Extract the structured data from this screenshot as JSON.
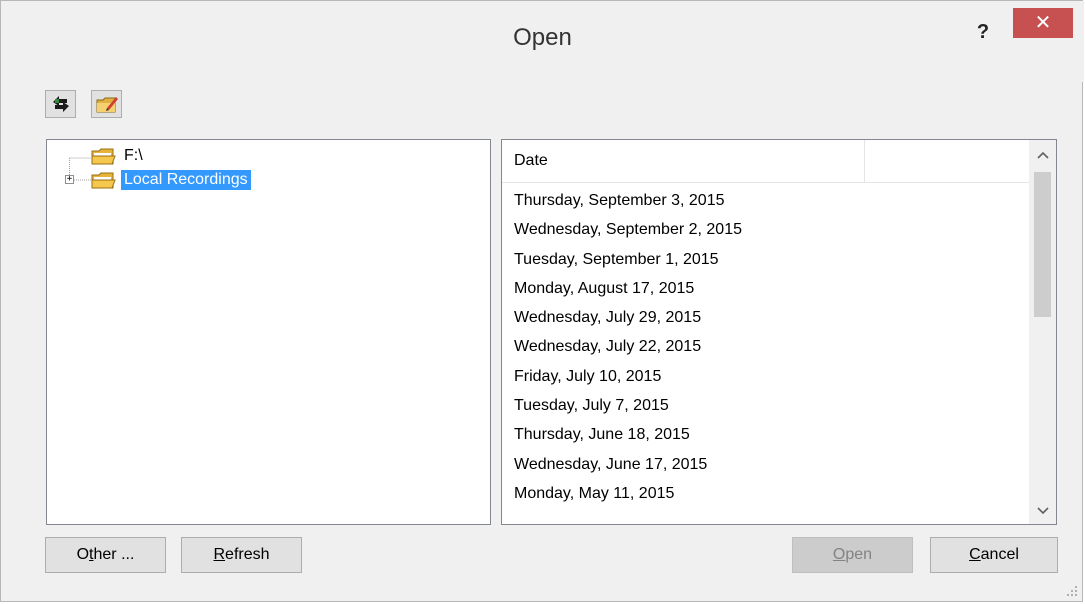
{
  "window": {
    "title": "Open",
    "help_label": "?",
    "close_label": "✕"
  },
  "toolbar": {
    "icons": [
      "refresh-sync-icon",
      "new-folder-icon"
    ]
  },
  "tree": {
    "items": [
      {
        "label": "F:\\",
        "icon": "folder-icon",
        "expandable": false,
        "selected": false
      },
      {
        "label": "Local Recordings",
        "icon": "folder-icon",
        "expandable": true,
        "expander": "+",
        "selected": true
      }
    ]
  },
  "list": {
    "columns": [
      "Date",
      ""
    ],
    "rows": [
      "Thursday, September 3, 2015",
      "Wednesday, September 2, 2015",
      "Tuesday, September 1, 2015",
      "Monday, August 17, 2015",
      "Wednesday, July 29, 2015",
      "Wednesday, July 22, 2015",
      "Friday, July 10, 2015",
      "Tuesday, July 7, 2015",
      "Thursday, June 18, 2015",
      "Wednesday, June 17, 2015",
      "Monday, May 11, 2015"
    ],
    "scroll_up": "^",
    "scroll_down": "v"
  },
  "buttons": {
    "other": {
      "pre": "O",
      "mnemonic": "t",
      "post": "her ..."
    },
    "refresh": {
      "pre": "",
      "mnemonic": "R",
      "post": "efresh"
    },
    "open": {
      "pre": "",
      "mnemonic": "O",
      "post": "pen",
      "disabled": true
    },
    "cancel": {
      "pre": "",
      "mnemonic": "C",
      "post": "ancel"
    }
  },
  "colors": {
    "selection": "#3399ff",
    "close_button": "#c75050",
    "folder": "#f5c74d"
  }
}
